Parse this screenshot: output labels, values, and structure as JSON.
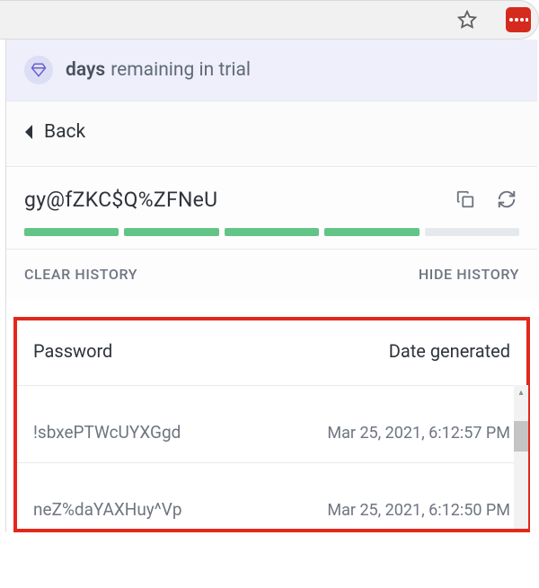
{
  "trial": {
    "strong": "days",
    "rest": "remaining in trial"
  },
  "back": {
    "label": "Back"
  },
  "password": {
    "value": "gy@fZKC$Q%ZFNeU",
    "strength_filled": 4,
    "strength_total": 5
  },
  "controls": {
    "clear": "CLEAR HISTORY",
    "hide": "HIDE HISTORY"
  },
  "history": {
    "headers": {
      "pw": "Password",
      "date": "Date generated"
    },
    "rows": [
      {
        "pw": "!sbxePTWcUYXGgd",
        "date": "Mar 25, 2021, 6:12:57 PM"
      },
      {
        "pw": "neZ%daYAXHuy^Vp",
        "date": "Mar 25, 2021, 6:12:50 PM"
      }
    ]
  }
}
